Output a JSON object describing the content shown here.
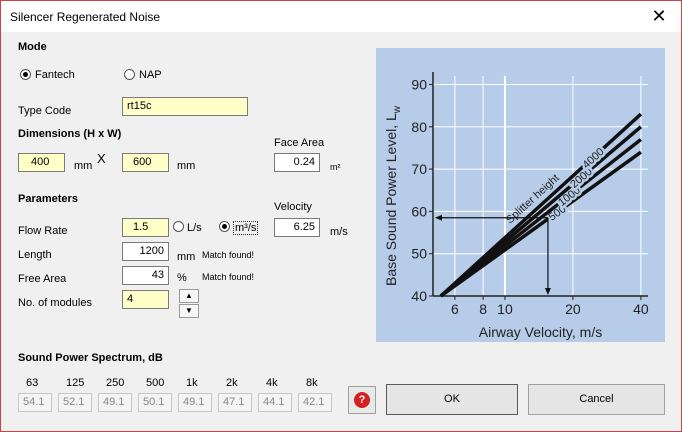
{
  "window": {
    "title": "Silencer Regenerated Noise",
    "close_glyph": "✕"
  },
  "mode": {
    "heading": "Mode",
    "option_fantech": "Fantech",
    "option_nap": "NAP",
    "selected": "Fantech"
  },
  "type_code": {
    "label": "Type Code",
    "value": "rt15c"
  },
  "dimensions": {
    "heading": "Dimensions (H x W)",
    "height": "400",
    "height_unit": "mm",
    "separator": "X",
    "width": "600",
    "width_unit": "mm",
    "face_area_label": "Face Area",
    "face_area": "0.24",
    "face_area_unit": "m²"
  },
  "parameters": {
    "heading": "Parameters",
    "flow_rate_label": "Flow Rate",
    "flow_rate": "1.5",
    "unit_ls": "L/s",
    "unit_m3s": "m³/s",
    "selected_unit": "m³/s",
    "velocity_label": "Velocity",
    "velocity": "6.25",
    "velocity_unit": "m/s",
    "length_label": "Length",
    "length": "1200",
    "length_unit": "mm",
    "length_status": "Match found!",
    "free_area_label": "Free Area",
    "free_area": "43",
    "free_area_unit": "%",
    "free_area_status": "Match found!",
    "modules_label": "No. of modules",
    "modules": "4"
  },
  "spectrum": {
    "heading": "Sound Power Spectrum, dB",
    "bands": [
      "63",
      "125",
      "250",
      "500",
      "1k",
      "2k",
      "4k",
      "8k"
    ],
    "values": [
      "54.1",
      "52.1",
      "49.1",
      "50.1",
      "49.1",
      "47.1",
      "44.1",
      "42.1"
    ]
  },
  "buttons": {
    "ok": "OK",
    "cancel": "Cancel",
    "help_glyph": "?"
  },
  "colors": {
    "chart_bg": "#b7cce8",
    "input_yellow": "#ffffc8"
  },
  "chart_data": {
    "type": "line",
    "title": "",
    "xlabel": "Airway Velocity, m/s",
    "ylabel": "Base Sound Power Level, L",
    "ylabel_subscript": "w",
    "x_scale": "log",
    "xlim": [
      4.8,
      43
    ],
    "ylim": [
      40,
      92
    ],
    "x_ticks": [
      6,
      8,
      10,
      20,
      40
    ],
    "y_ticks": [
      40,
      50,
      60,
      70,
      80,
      90
    ],
    "series_note": "Splitter height",
    "series": [
      {
        "name": "500",
        "x": [
          5.2,
          40
        ],
        "y": [
          40,
          74
        ]
      },
      {
        "name": "1000",
        "x": [
          5.2,
          40
        ],
        "y": [
          40,
          77
        ]
      },
      {
        "name": "2000",
        "x": [
          5.2,
          40
        ],
        "y": [
          40,
          80
        ]
      },
      {
        "name": "4000",
        "x": [
          5.2,
          40
        ],
        "y": [
          40,
          83
        ]
      }
    ],
    "reading": {
      "x": 15.5,
      "y": 58.5
    }
  }
}
